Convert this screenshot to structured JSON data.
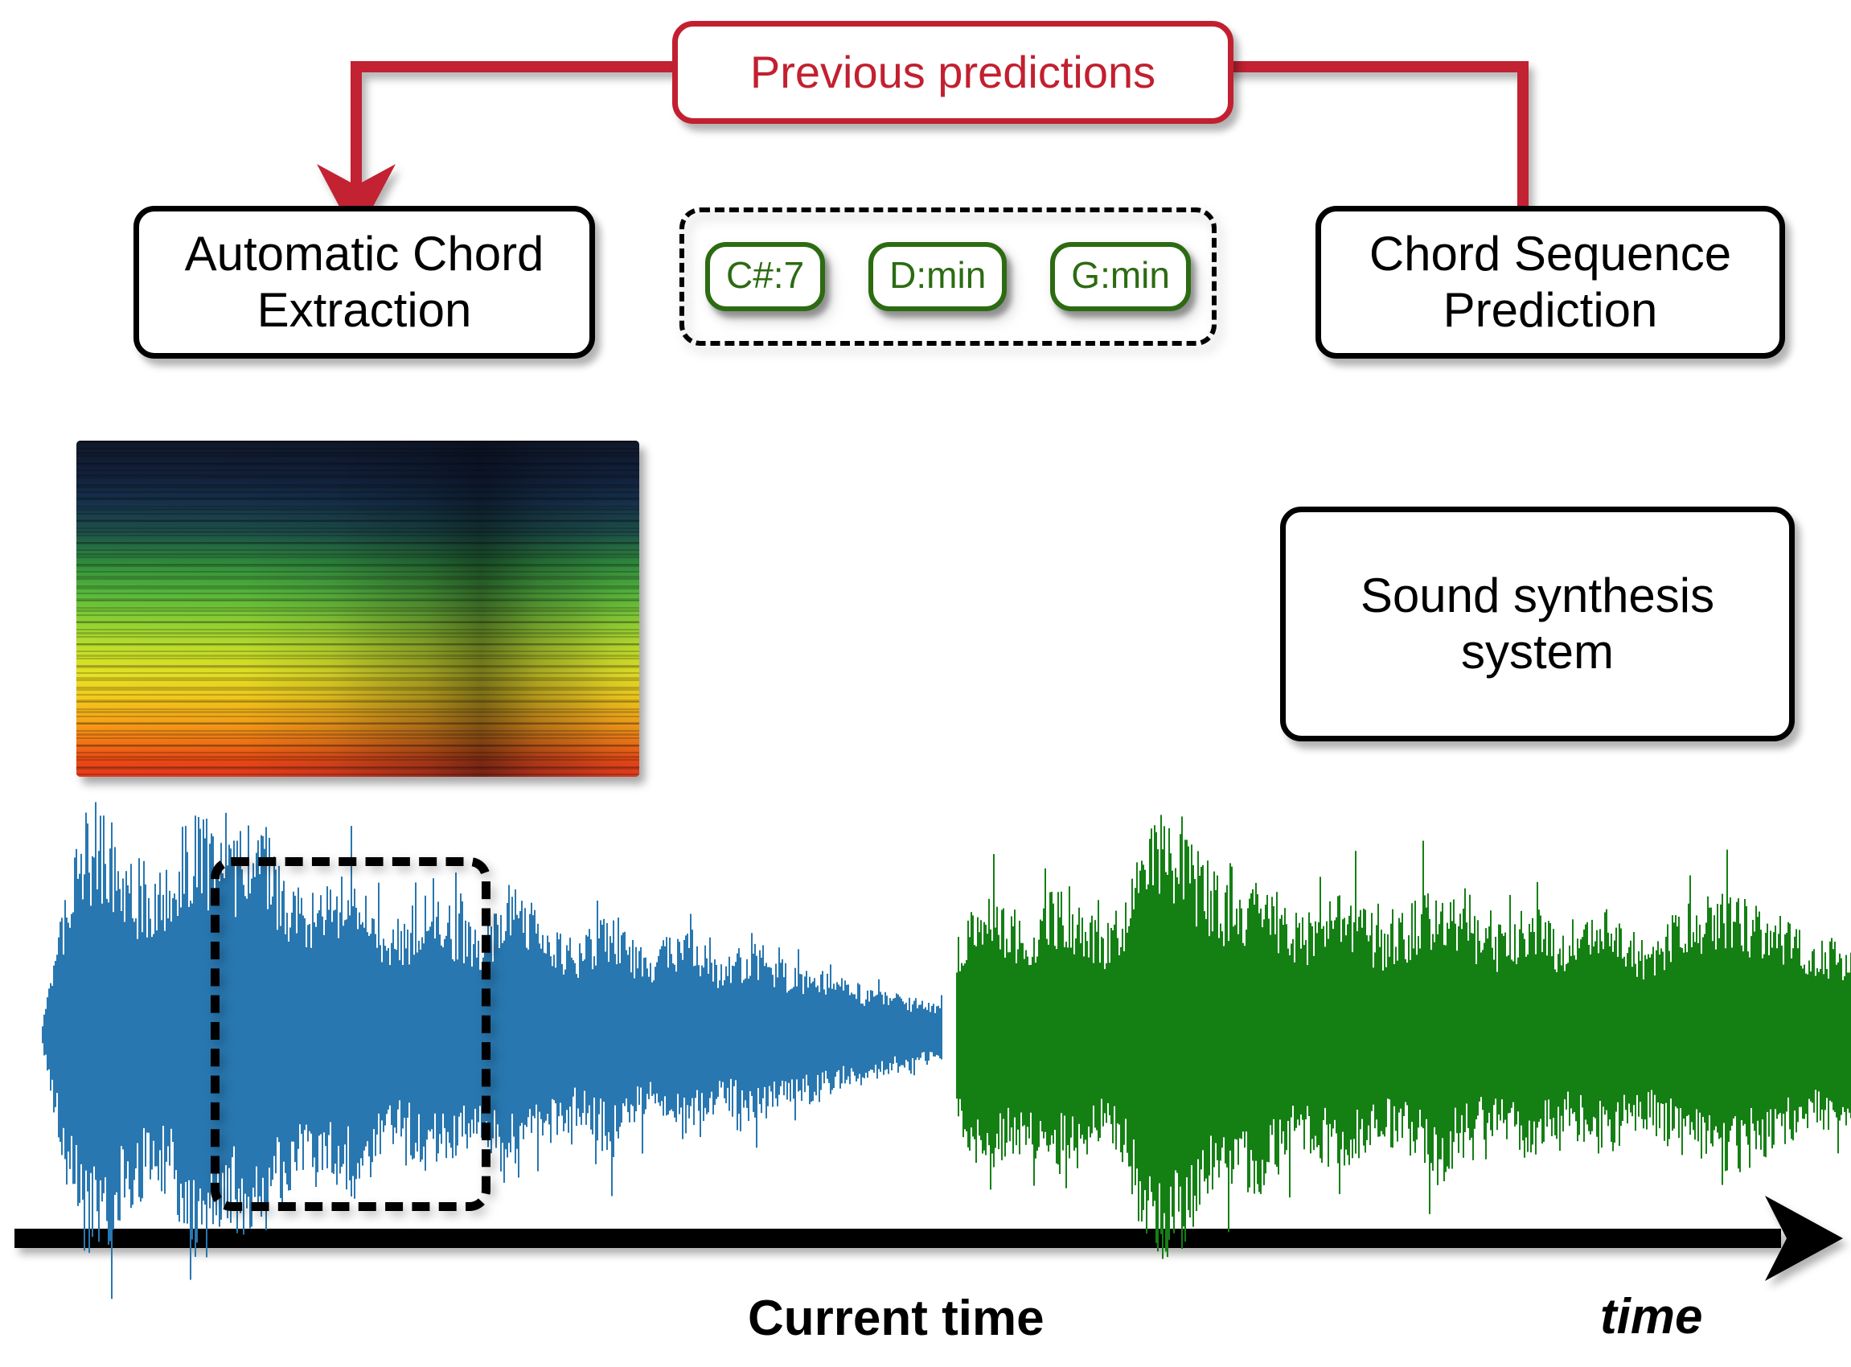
{
  "diagram": {
    "title": "Automatic chord extraction and prediction pipeline",
    "colors": {
      "red": "#C22030",
      "green_chord": "#2C6B12",
      "waveform_past": "#2877B0",
      "waveform_future": "#148014",
      "black": "#000000"
    },
    "feedback": {
      "label": "Previous predictions"
    },
    "nodes": {
      "extraction": {
        "label": "Automatic Chord\nExtraction"
      },
      "prediction": {
        "label": "Chord Sequence\nPrediction"
      },
      "synthesis": {
        "label": "Sound synthesis\nsystem"
      }
    },
    "chords": {
      "items": [
        {
          "label": "C#:7"
        },
        {
          "label": "D:min"
        },
        {
          "label": "G:min"
        }
      ]
    },
    "axis": {
      "current_time_label": "Current time",
      "time_label": "time"
    },
    "signals": {
      "past_label": "past audio waveform",
      "future_label": "synthesised audio waveform",
      "spectrogram_label": "spectrogram"
    }
  },
  "chart_data": {
    "type": "area",
    "title": "Audio waveform timeline split at current time",
    "xlabel": "time",
    "ylabel": "",
    "series": [
      {
        "name": "past audio (blue)",
        "color": "#2877B0",
        "x_range": [
          0,
          0.486
        ],
        "envelope": [
          0.05,
          0.52,
          0.88,
          1.0,
          0.84,
          0.72,
          0.66,
          0.7,
          0.95,
          0.9,
          0.78,
          0.86,
          0.92,
          0.74,
          0.62,
          0.58,
          0.64,
          0.7,
          0.55,
          0.48,
          0.52,
          0.6,
          0.56,
          0.5,
          0.46,
          0.58,
          0.62,
          0.5,
          0.44,
          0.4,
          0.46,
          0.52,
          0.42,
          0.36,
          0.4,
          0.48,
          0.38,
          0.32,
          0.34,
          0.4,
          0.33,
          0.28,
          0.3,
          0.26,
          0.22,
          0.2,
          0.18,
          0.16,
          0.14,
          0.12
        ]
      },
      {
        "name": "future synthesised audio (green)",
        "color": "#148014",
        "x_range": [
          0.495,
          0.985
        ],
        "envelope": [
          0.42,
          0.55,
          0.6,
          0.52,
          0.48,
          0.56,
          0.62,
          0.5,
          0.46,
          0.58,
          0.88,
          1.0,
          0.92,
          0.78,
          0.66,
          0.6,
          0.7,
          0.62,
          0.54,
          0.5,
          0.56,
          0.6,
          0.52,
          0.46,
          0.5,
          0.58,
          0.64,
          0.54,
          0.48,
          0.44,
          0.5,
          0.56,
          0.46,
          0.42,
          0.48,
          0.52,
          0.44,
          0.4,
          0.46,
          0.52,
          0.58,
          0.64,
          0.6,
          0.54,
          0.5,
          0.46,
          0.42,
          0.4,
          0.38,
          0.34
        ]
      }
    ],
    "annotations": [
      {
        "text": "Current time",
        "x": 0.49,
        "type": "vertical-dash-dot-line"
      },
      {
        "text": "time",
        "x": 0.99,
        "type": "axis-arrow"
      }
    ],
    "grid": false,
    "legend": "none"
  }
}
